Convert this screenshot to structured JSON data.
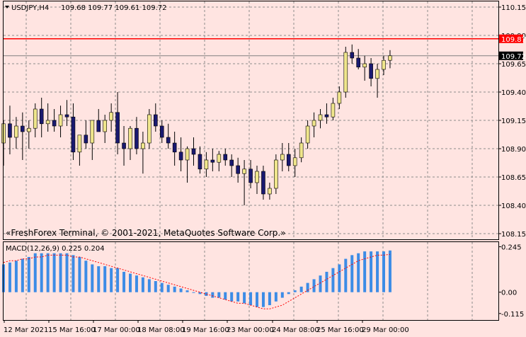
{
  "header": {
    "symbol": "USDJPY,H4",
    "ohlc": "109.68 109.77 109.61 109.72"
  },
  "copyright": "«FreshForex Terminal, © 2001-2021, MetaQuotes Software Corp.»",
  "macd_label": "MACD(12,26,9) 0.225 0.204",
  "colors": {
    "background": "#ffe4e1",
    "bull_body": "#f0e68c",
    "bear_body": "#191970",
    "grid": "#8c8c8c",
    "resistance_line": "#ff0000",
    "last_price_line": "#808080",
    "histogram": "#3c8ce6",
    "signal": "#ff0000"
  },
  "chart_data": [
    {
      "type": "candlestick",
      "name": "USDJPY,H4",
      "ylim": [
        108.1,
        110.2
      ],
      "y_ticks": [
        "110.15",
        "109.90",
        "109.65",
        "109.40",
        "109.15",
        "108.90",
        "108.65",
        "108.40",
        "108.15"
      ],
      "x_ticks": [
        "12 Mar 2021",
        "15 Mar 16:00",
        "17 Mar 00:00",
        "18 Mar 08:00",
        "19 Mar 16:00",
        "23 Mar 00:00",
        "24 Mar 08:00",
        "25 Mar 16:00",
        "29 Mar 00:00"
      ],
      "resistance_level": "109.87",
      "last_price": "109.72",
      "ohlc": [
        [
          108.95,
          109.15,
          108.75,
          109.12
        ],
        [
          109.12,
          109.28,
          108.85,
          109.0
        ],
        [
          109.0,
          109.18,
          108.9,
          109.1
        ],
        [
          109.1,
          109.22,
          108.8,
          109.05
        ],
        [
          109.05,
          109.15,
          108.9,
          109.08
        ],
        [
          109.08,
          109.3,
          109.0,
          109.25
        ],
        [
          109.25,
          109.35,
          109.0,
          109.12
        ],
        [
          109.12,
          109.3,
          109.05,
          109.15
        ],
        [
          109.15,
          109.25,
          109.05,
          109.1
        ],
        [
          109.1,
          109.28,
          109.0,
          109.2
        ],
        [
          109.2,
          109.33,
          109.1,
          109.18
        ],
        [
          109.18,
          109.3,
          108.8,
          108.87
        ],
        [
          108.87,
          108.95,
          108.75,
          109.02
        ],
        [
          109.02,
          109.15,
          108.9,
          108.95
        ],
        [
          108.95,
          109.12,
          108.8,
          109.15
        ],
        [
          109.15,
          109.25,
          109.05,
          109.05
        ],
        [
          109.05,
          109.2,
          108.95,
          109.15
        ],
        [
          109.15,
          109.3,
          109.05,
          109.22
        ],
        [
          109.22,
          109.4,
          108.85,
          108.95
        ],
        [
          108.95,
          109.1,
          108.75,
          108.9
        ],
        [
          108.9,
          109.1,
          108.8,
          109.08
        ],
        [
          109.08,
          109.18,
          108.85,
          108.9
        ],
        [
          108.9,
          109.05,
          108.68,
          108.95
        ],
        [
          108.95,
          109.25,
          108.9,
          109.2
        ],
        [
          109.2,
          109.3,
          109.05,
          109.1
        ],
        [
          109.1,
          109.15,
          108.95,
          109.0
        ],
        [
          109.0,
          109.12,
          108.9,
          108.95
        ],
        [
          108.95,
          109.05,
          108.75,
          108.87
        ],
        [
          108.87,
          109.0,
          108.7,
          108.8
        ],
        [
          108.8,
          108.92,
          108.6,
          108.9
        ],
        [
          108.9,
          109.0,
          108.75,
          108.85
        ],
        [
          108.85,
          108.92,
          108.68,
          108.72
        ],
        [
          108.72,
          108.87,
          108.65,
          108.8
        ],
        [
          108.8,
          108.9,
          108.7,
          108.78
        ],
        [
          108.78,
          108.88,
          108.7,
          108.85
        ],
        [
          108.85,
          108.9,
          108.75,
          108.8
        ],
        [
          108.8,
          108.85,
          108.65,
          108.75
        ],
        [
          108.75,
          108.82,
          108.6,
          108.68
        ],
        [
          108.68,
          108.8,
          108.4,
          108.72
        ],
        [
          108.72,
          108.8,
          108.55,
          108.6
        ],
        [
          108.6,
          108.75,
          108.5,
          108.7
        ],
        [
          108.7,
          108.75,
          108.45,
          108.5
        ],
        [
          108.5,
          108.6,
          108.45,
          108.55
        ],
        [
          108.55,
          108.85,
          108.5,
          108.8
        ],
        [
          108.8,
          108.95,
          108.7,
          108.85
        ],
        [
          108.85,
          108.95,
          108.7,
          108.75
        ],
        [
          108.75,
          108.9,
          108.65,
          108.82
        ],
        [
          108.82,
          109.0,
          108.78,
          108.95
        ],
        [
          108.95,
          109.15,
          108.9,
          109.1
        ],
        [
          109.1,
          109.22,
          109.0,
          109.15
        ],
        [
          109.15,
          109.25,
          109.08,
          109.2
        ],
        [
          109.2,
          109.3,
          109.12,
          109.18
        ],
        [
          109.18,
          109.35,
          109.15,
          109.3
        ],
        [
          109.3,
          109.45,
          109.25,
          109.4
        ],
        [
          109.4,
          109.8,
          109.35,
          109.75
        ],
        [
          109.75,
          109.82,
          109.65,
          109.7
        ],
        [
          109.7,
          109.78,
          109.6,
          109.62
        ],
        [
          109.62,
          109.72,
          109.5,
          109.65
        ],
        [
          109.65,
          109.7,
          109.45,
          109.52
        ],
        [
          109.52,
          109.65,
          109.35,
          109.6
        ],
        [
          109.6,
          109.72,
          109.55,
          109.68
        ],
        [
          109.68,
          109.77,
          109.61,
          109.72
        ]
      ]
    },
    {
      "type": "bar",
      "name": "MACD(12,26,9)",
      "ylim": [
        -0.15,
        0.27
      ],
      "y_ticks": [
        "0.245",
        "0.00",
        "-0.115"
      ],
      "histogram": [
        0.15,
        0.16,
        0.17,
        0.18,
        0.19,
        0.21,
        0.21,
        0.21,
        0.21,
        0.21,
        0.21,
        0.2,
        0.19,
        0.17,
        0.15,
        0.14,
        0.14,
        0.13,
        0.13,
        0.11,
        0.1,
        0.09,
        0.08,
        0.07,
        0.06,
        0.05,
        0.04,
        0.03,
        0.02,
        0.01,
        0.0,
        -0.01,
        -0.02,
        -0.03,
        -0.03,
        -0.04,
        -0.05,
        -0.05,
        -0.06,
        -0.07,
        -0.08,
        -0.08,
        -0.07,
        -0.05,
        -0.03,
        -0.01,
        0.01,
        0.03,
        0.05,
        0.07,
        0.09,
        0.11,
        0.13,
        0.15,
        0.18,
        0.2,
        0.21,
        0.22,
        0.22,
        0.22,
        0.22,
        0.225
      ],
      "signal": [
        0.16,
        0.17,
        0.17,
        0.18,
        0.18,
        0.19,
        0.19,
        0.2,
        0.2,
        0.2,
        0.2,
        0.19,
        0.19,
        0.18,
        0.17,
        0.16,
        0.15,
        0.14,
        0.13,
        0.12,
        0.11,
        0.1,
        0.09,
        0.08,
        0.07,
        0.06,
        0.05,
        0.04,
        0.03,
        0.02,
        0.01,
        0.0,
        -0.01,
        -0.02,
        -0.03,
        -0.04,
        -0.05,
        -0.06,
        -0.06,
        -0.07,
        -0.08,
        -0.09,
        -0.09,
        -0.08,
        -0.07,
        -0.05,
        -0.03,
        -0.01,
        0.01,
        0.03,
        0.05,
        0.07,
        0.09,
        0.11,
        0.13,
        0.15,
        0.17,
        0.18,
        0.19,
        0.2,
        0.2,
        0.204
      ]
    }
  ]
}
